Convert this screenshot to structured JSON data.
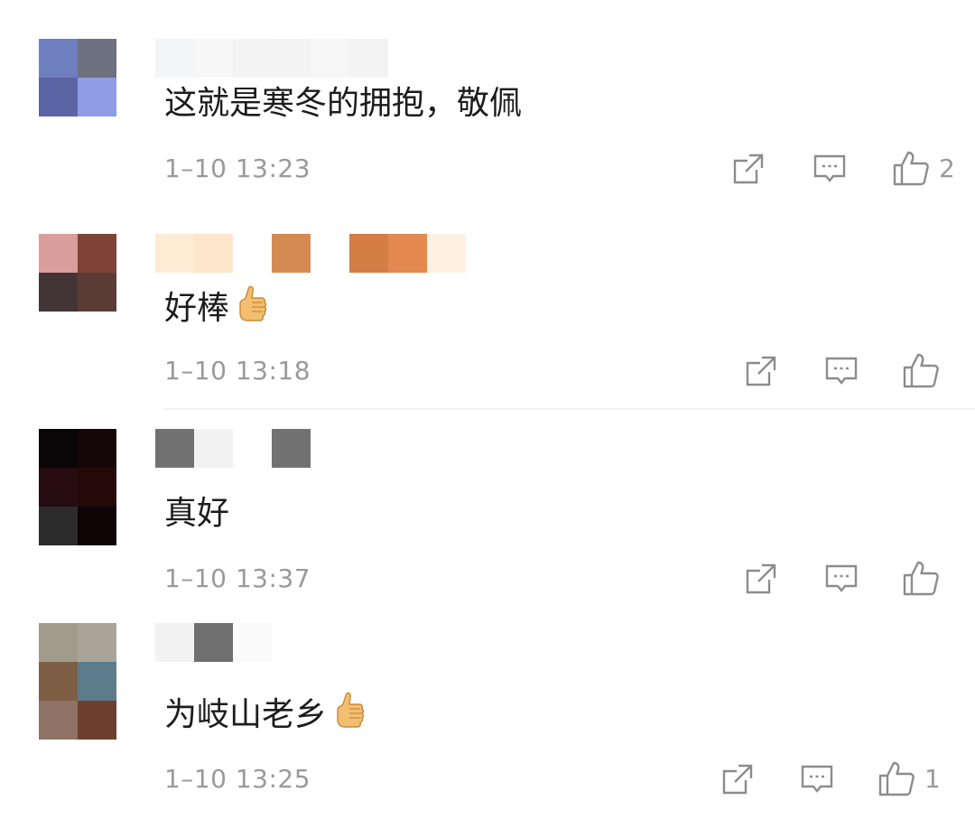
{
  "comments": [
    {
      "text": "这就是寒冬的拥抱，敬佩",
      "time": "1–10 13:23",
      "likes": "2",
      "avatar": [
        "#6e7fbf",
        "#6d717f",
        "#5b64a4",
        "#8e9de6"
      ],
      "username_blocks": [
        "#f4f5f7",
        "#f7f7f7",
        "#f4f4f4",
        "#f3f3f3",
        "#f6f6f6",
        "#f3f3f3"
      ]
    },
    {
      "text": "好棒",
      "has_thumb_emoji": true,
      "time": "1–10 13:18",
      "likes": "",
      "avatar": [
        "#d99e9c",
        "#7f4238",
        "#433436",
        "#5b3b35"
      ],
      "username_blocks": [
        "#fdebd4",
        "#fde5cc",
        "#ffffff",
        "#d58a52",
        "#ffffff",
        "#d47d44",
        "#e4894f",
        "#fff1e2"
      ]
    },
    {
      "text": "真好",
      "time": "1–10 13:37",
      "likes": "",
      "avatar": [
        "#0a0506",
        "#150607",
        "#260c10",
        "#250909",
        "#2c2b2b",
        "#0b0506"
      ],
      "username_blocks": [
        "#727272",
        "#f2f2f2",
        "#ffffff",
        "#727272"
      ]
    },
    {
      "text": "为岐山老乡",
      "has_thumb_emoji": true,
      "time": "1–10 13:25",
      "likes": "1",
      "avatar": [
        "#a09b8b",
        "#a8a598",
        "#7f5e46",
        "#5c7c8c",
        "#8e7266",
        "#6e3e2f"
      ],
      "username_blocks": [
        "#f2f2f2",
        "#6f6f6f",
        "#fafafa"
      ]
    }
  ],
  "icons": {
    "share": "share-icon",
    "reply": "comment-icon",
    "like": "thumbs-up-icon"
  },
  "colors": {
    "text": "#1c1c1c",
    "meta": "#9a9a9a",
    "icon": "#8c8c8c"
  }
}
